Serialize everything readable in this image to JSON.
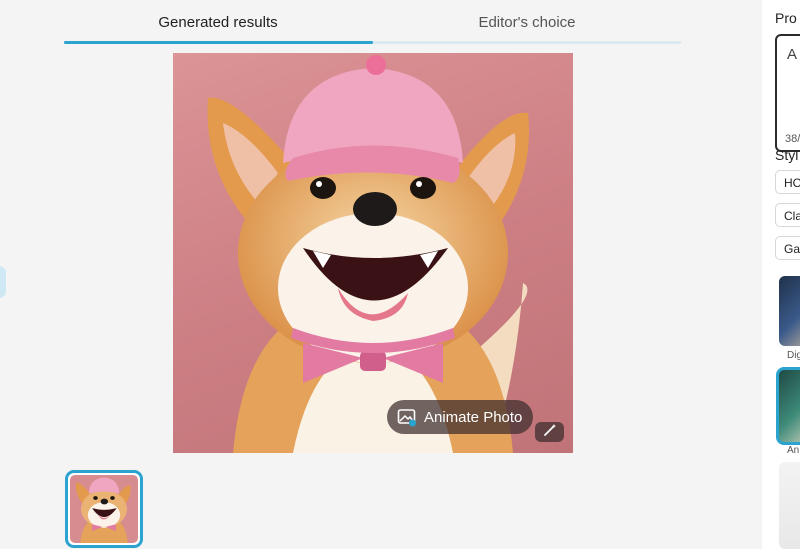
{
  "tabs": [
    {
      "label": "Generated results",
      "active": true
    },
    {
      "label": "Editor's choice",
      "active": false
    }
  ],
  "image": {
    "description_icon": "image-icon",
    "animate_label": "Animate Photo",
    "wand_icon": "magic-wand-icon"
  },
  "right_panel": {
    "prompt_label": "Pro",
    "prompt_text": "A c",
    "prompt_count": "38/",
    "style_label": "Styl",
    "chips": [
      "HO",
      "Cla",
      "Ga"
    ],
    "style_captions": [
      "Dig",
      "An"
    ]
  },
  "colors": {
    "accent": "#2aa3cf",
    "background": "#f4f4f4",
    "image_bg": "#cf8589"
  }
}
